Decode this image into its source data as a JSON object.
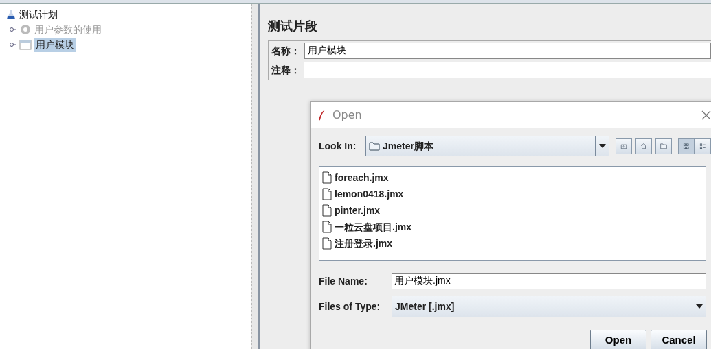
{
  "tree": {
    "label": "测试计划",
    "children": [
      {
        "label": "用户参数的使用",
        "disabled": true,
        "selected": false
      },
      {
        "label": "用户模块",
        "disabled": false,
        "selected": true
      }
    ]
  },
  "panel": {
    "title": "测试片段",
    "fields": [
      {
        "label": "名称：",
        "value": "用户模块"
      },
      {
        "label": "注释："
      }
    ]
  },
  "dialog": {
    "title": "Open",
    "look_in": {
      "label": "Look In:",
      "value": "Jmeter脚本"
    },
    "view_buttons": [
      {
        "kind": "list",
        "selected": true
      },
      {
        "kind": "details",
        "selected": false
      }
    ],
    "files": [
      {
        "name": "foreach.jmx"
      },
      {
        "name": "lemon0418.jmx"
      },
      {
        "name": "pinter.jmx"
      },
      {
        "name": "一粒云盘项目.jmx"
      },
      {
        "name": "注册登录.jmx"
      }
    ],
    "file_name": {
      "label": "File Name:",
      "value": "用户模块.jmx"
    },
    "file_type": {
      "label": "Files of Type:",
      "value": "JMeter [.jmx]"
    },
    "buttons": [
      "Open",
      "Cancel"
    ]
  }
}
